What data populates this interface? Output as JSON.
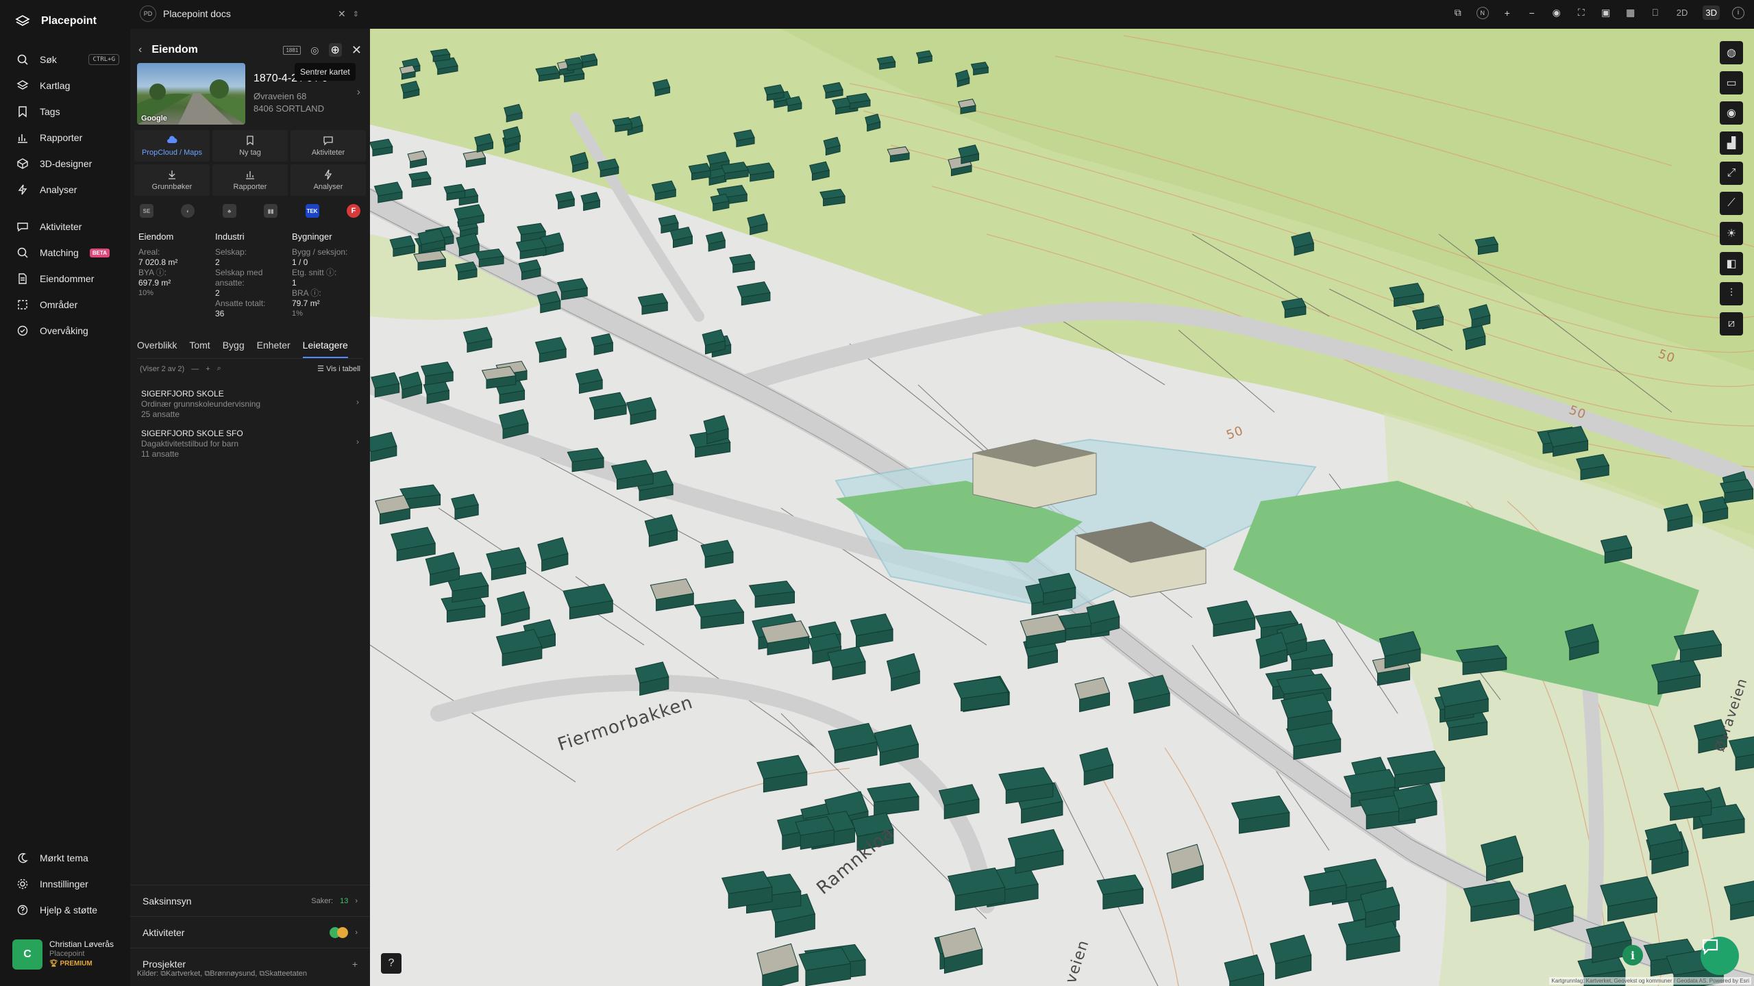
{
  "app": {
    "name": "Placepoint"
  },
  "nav": {
    "items": [
      {
        "label": "Søk",
        "shortcut": "CTRL+G",
        "icon": "search-icon"
      },
      {
        "label": "Kartlag",
        "icon": "layers-icon"
      },
      {
        "label": "Tags",
        "icon": "bookmark-icon"
      },
      {
        "label": "Rapporter",
        "icon": "chart-icon"
      },
      {
        "label": "3D-designer",
        "icon": "cube-icon"
      },
      {
        "label": "Analyser",
        "icon": "lightning-icon"
      },
      {
        "label": "Aktiviteter",
        "icon": "chat-icon"
      },
      {
        "label": "Matching",
        "badge": "BETA",
        "icon": "magnifier-icon"
      },
      {
        "label": "Eiendommer",
        "icon": "document-icon"
      },
      {
        "label": "Områder",
        "icon": "area-icon"
      },
      {
        "label": "Overvåking",
        "icon": "monitor-icon"
      }
    ],
    "bottom": [
      {
        "label": "Mørkt tema",
        "icon": "moon-icon"
      },
      {
        "label": "Innstillinger",
        "icon": "gear-icon"
      },
      {
        "label": "Hjelp & støtte",
        "icon": "help-icon"
      }
    ],
    "user": {
      "initial": "C",
      "name": "Christian Løverås",
      "org": "Placepoint",
      "plan": "PREMIUM"
    }
  },
  "topbar": {
    "doc_badge": "PD",
    "doc_title": "Placepoint docs",
    "view_2d": "2D",
    "view_3d": "3D",
    "active_view": "3D"
  },
  "panel": {
    "title": "Eiendom",
    "tooltip": "Sentrer kartet",
    "photo_label": "Google",
    "gnr": "1870-4-2 / 0 / 0",
    "address": "Øvraveien 68",
    "postal": "8406 SORTLAND",
    "actions": [
      {
        "label": "PropCloud / Maps",
        "icon": "cloud-icon"
      },
      {
        "label": "Ny tag",
        "icon": "bookmark-icon"
      },
      {
        "label": "Aktiviteter",
        "icon": "chat-icon"
      },
      {
        "label": "Grunnbøker",
        "icon": "download-icon"
      },
      {
        "label": "Rapporter",
        "icon": "chart-icon"
      },
      {
        "label": "Analyser",
        "icon": "lightning-icon"
      }
    ],
    "sources": [
      "SE",
      "",
      "",
      "",
      "TEK",
      "F"
    ],
    "stats": {
      "eiendom": {
        "title": "Eiendom",
        "areal_k": "Areal:",
        "areal_v": "7 020.8 m²",
        "bya_k": "BYA ⓘ:",
        "bya_v": "697.9 m²",
        "bya_pct": "10%"
      },
      "industri": {
        "title": "Industri",
        "selskap_k": "Selskap:",
        "selskap_v": "2",
        "ansatte_k": "Selskap med ansatte:",
        "ansatte_v": "2",
        "totalt_k": "Ansatte totalt:",
        "totalt_v": "36"
      },
      "bygninger": {
        "title": "Bygninger",
        "bygg_k": "Bygg / seksjon:",
        "bygg_v": "1 / 0",
        "etg_k": "Etg. snitt ⓘ:",
        "etg_v": "1",
        "bra_k": "BRA ⓘ:",
        "bra_v": "79.7 m²",
        "bra_pct": "1%"
      }
    },
    "tabs": [
      "Overblikk",
      "Tomt",
      "Bygg",
      "Enheter",
      "Leietagere"
    ],
    "active_tab": "Leietagere",
    "list_count": "(Viser 2 av 2)",
    "list_view": "Vis i tabell",
    "tenants": [
      {
        "name": "SIGERFJORD SKOLE",
        "desc": "Ordinær grunnskoleundervisning",
        "emp": "25 ansatte"
      },
      {
        "name": "SIGERFJORD SKOLE SFO",
        "desc": "Dagaktivitetstilbud for barn",
        "emp": "11 ansatte"
      }
    ],
    "sections": {
      "saksinnsyn": {
        "label": "Saksinnsyn",
        "saker_label": "Saker:",
        "saker_value": "13"
      },
      "aktiviteter": {
        "label": "Aktiviteter"
      },
      "prosjekter": {
        "label": "Prosjekter"
      }
    },
    "kilder": {
      "label": "Kilder:",
      "items": [
        "Kartverket",
        "Brønnøysund",
        "Skatteetaten"
      ]
    }
  },
  "map": {
    "roads": [
      "Fiermorbakken",
      "Ramnkloa",
      "Øvraveien",
      "veien"
    ],
    "contours": [
      "50",
      "50",
      "50"
    ],
    "attribution": "Kartgrunnlag: Kartverket, Geovekst og kommuner / Geodata AS. Powered by Esri",
    "colors": {
      "building": "#1f5e50",
      "selected": "#d8d8c4",
      "field": "#7fc47e",
      "vegetation": "#c9dd9c"
    }
  }
}
